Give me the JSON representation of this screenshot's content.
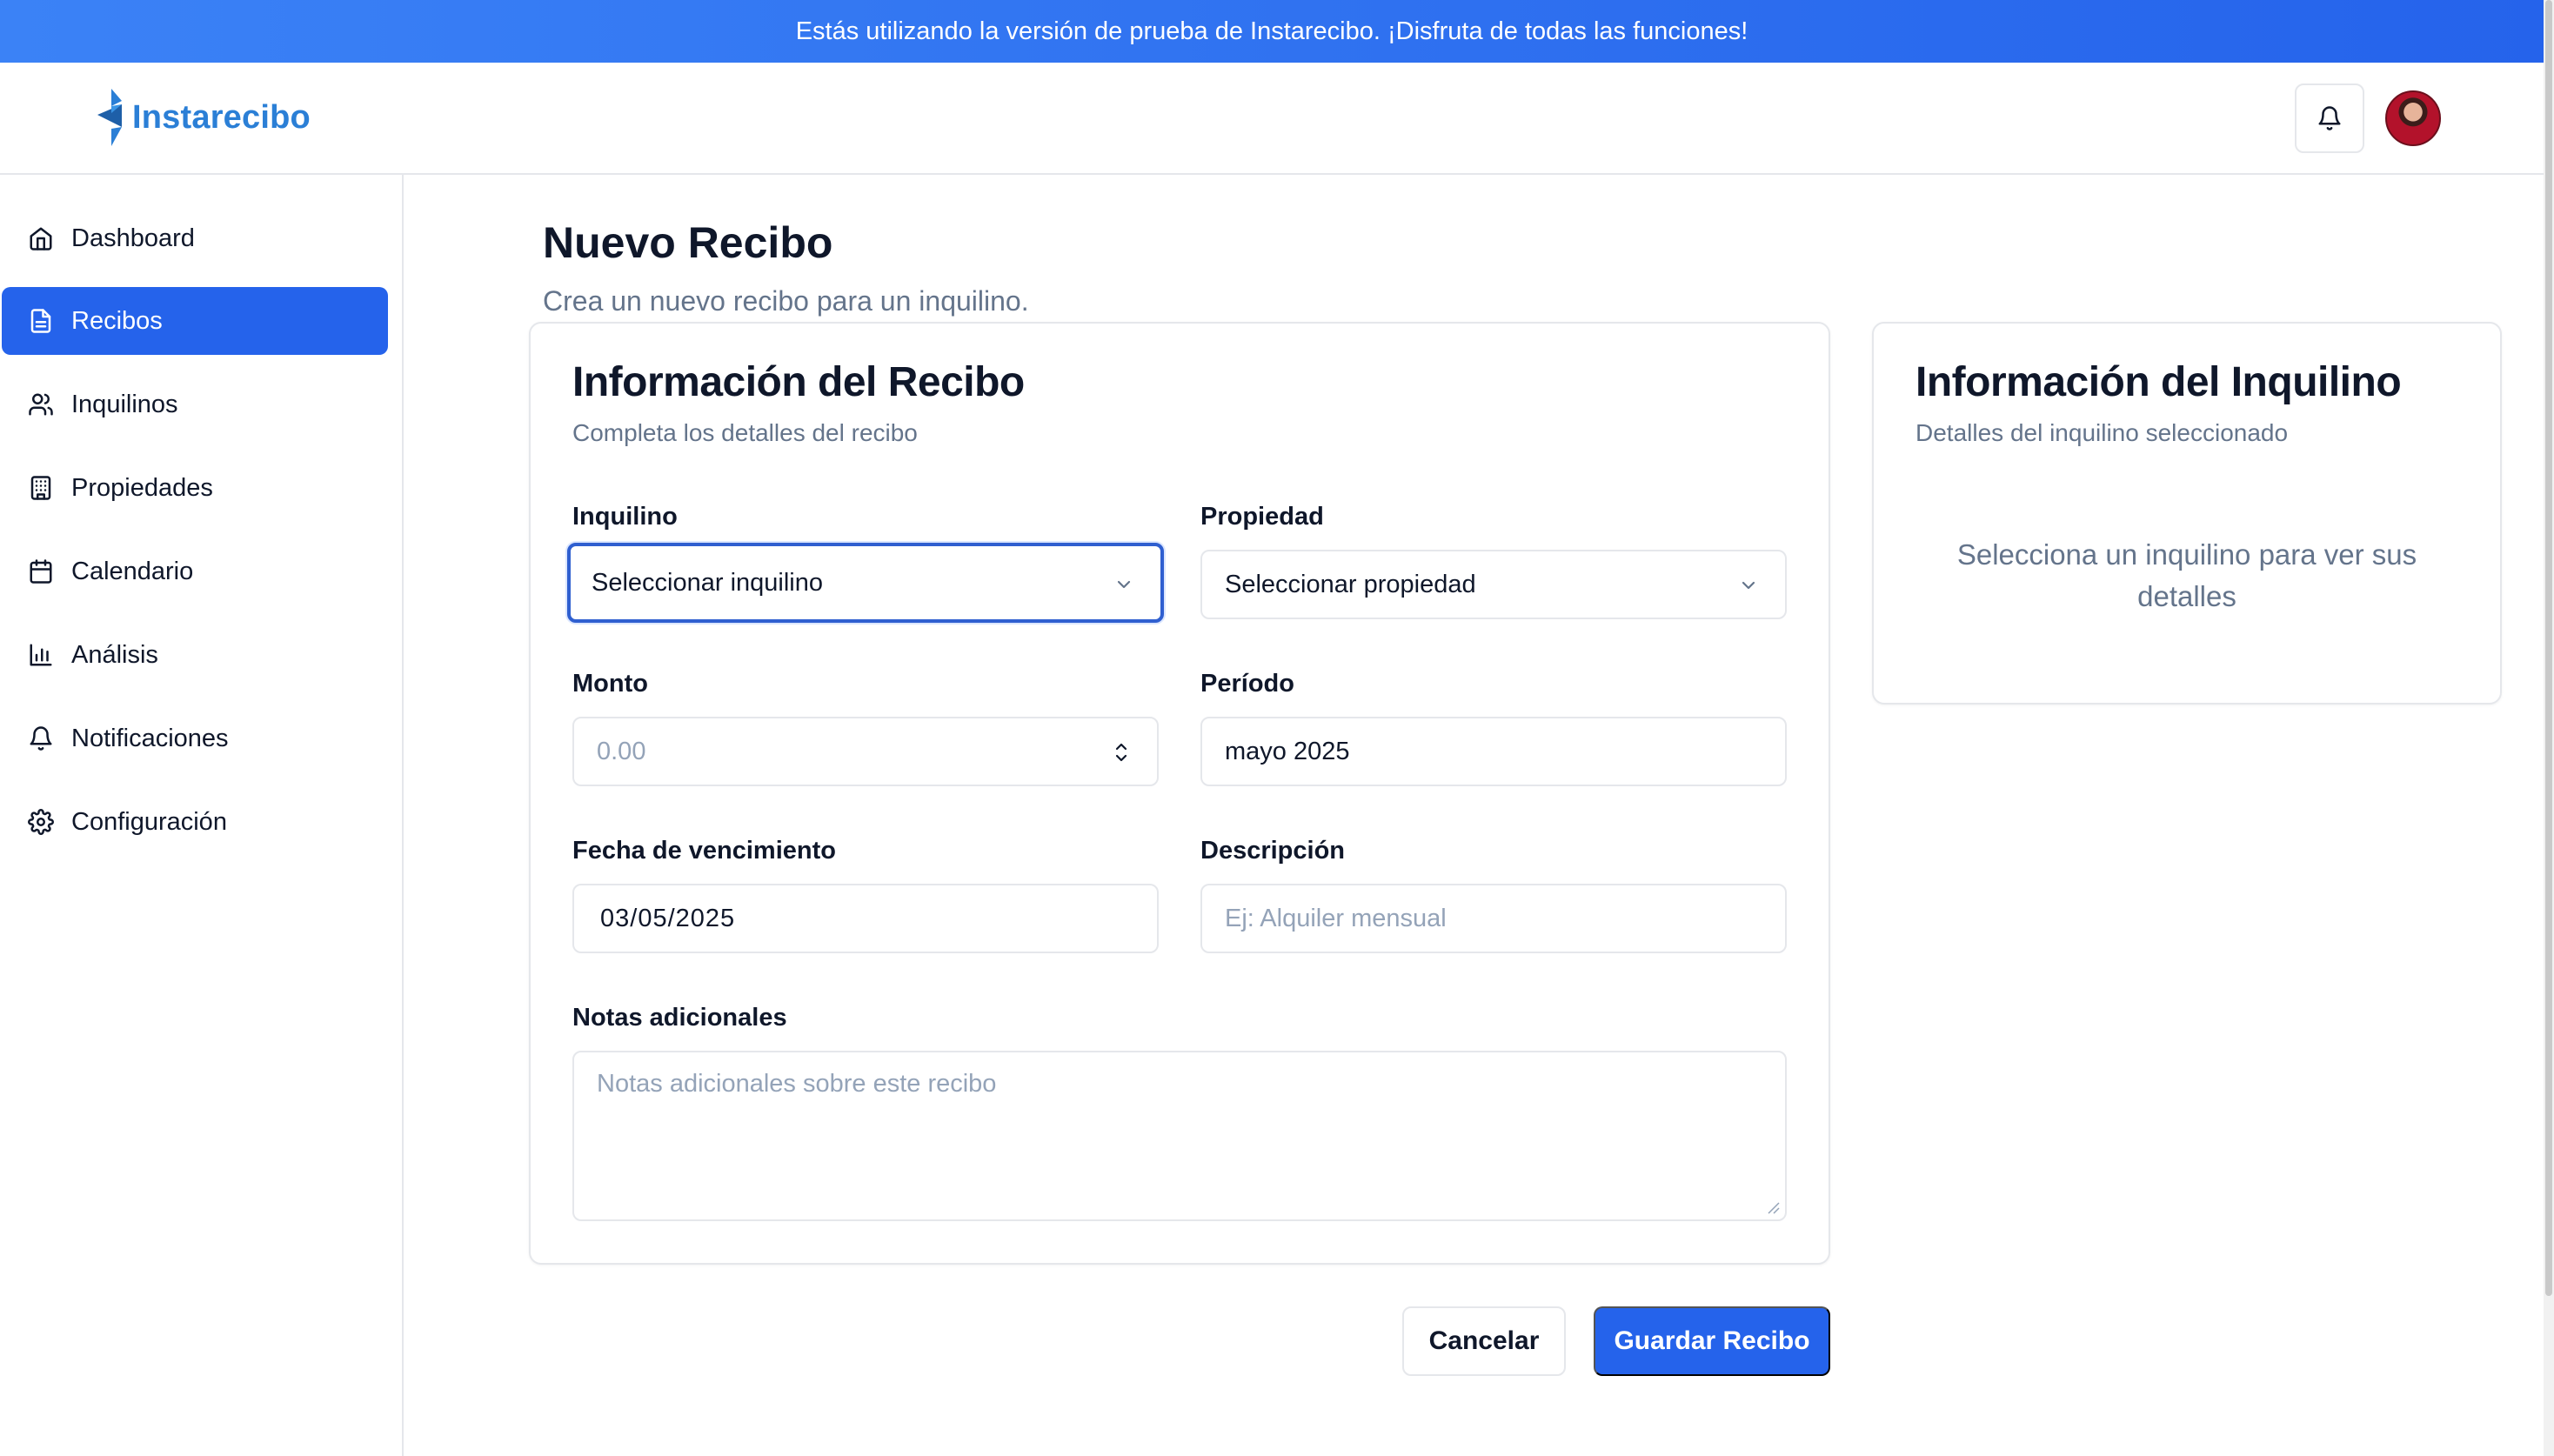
{
  "banner": {
    "text": "Estás utilizando la versión de prueba de Instarecibo. ¡Disfruta de todas las funciones!"
  },
  "header": {
    "brand": "Instarecibo"
  },
  "sidebar": {
    "items": [
      {
        "label": "Dashboard",
        "icon": "home-icon",
        "active": false
      },
      {
        "label": "Recibos",
        "icon": "file-text-icon",
        "active": true
      },
      {
        "label": "Inquilinos",
        "icon": "users-icon",
        "active": false
      },
      {
        "label": "Propiedades",
        "icon": "building-icon",
        "active": false
      },
      {
        "label": "Calendario",
        "icon": "calendar-icon",
        "active": false
      },
      {
        "label": "Análisis",
        "icon": "bar-chart-icon",
        "active": false
      },
      {
        "label": "Notificaciones",
        "icon": "bell-icon",
        "active": false
      },
      {
        "label": "Configuración",
        "icon": "gear-icon",
        "active": false
      }
    ]
  },
  "page": {
    "title": "Nuevo Recibo",
    "subtitle": "Crea un nuevo recibo para un inquilino."
  },
  "form_card": {
    "title": "Información del Recibo",
    "description": "Completa los detalles del recibo",
    "fields": {
      "tenant": {
        "label": "Inquilino",
        "value": "Seleccionar inquilino"
      },
      "property": {
        "label": "Propiedad",
        "value": "Seleccionar propiedad"
      },
      "amount": {
        "label": "Monto",
        "placeholder": "0.00"
      },
      "period": {
        "label": "Período",
        "value": "mayo 2025"
      },
      "due_date": {
        "label": "Fecha de vencimiento",
        "value": "03/05/2025"
      },
      "description": {
        "label": "Descripción",
        "placeholder": "Ej: Alquiler mensual"
      },
      "notes": {
        "label": "Notas adicionales",
        "placeholder": "Notas adicionales sobre este recibo"
      }
    }
  },
  "tenant_card": {
    "title": "Información del Inquilino",
    "description": "Detalles del inquilino seleccionado",
    "empty_message": "Selecciona un inquilino para ver sus detalles"
  },
  "actions": {
    "cancel_label": "Cancelar",
    "save_label": "Guardar Recibo"
  },
  "colors": {
    "primary": "#2563eb",
    "brand": "#2b7fd6",
    "muted_text": "#64748b",
    "border": "#e5e7eb"
  }
}
